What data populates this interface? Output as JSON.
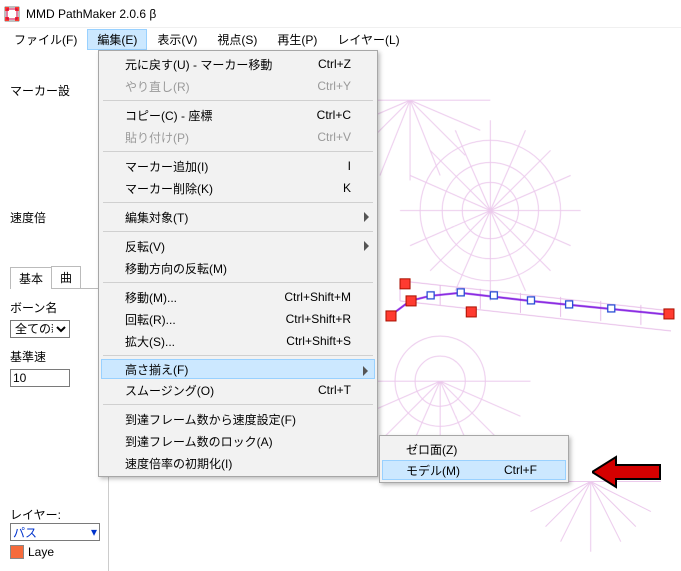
{
  "title": "MMD PathMaker 2.0.6 β",
  "menubar": {
    "file": "ファイル(F)",
    "edit": "編集(E)",
    "view": "表示(V)",
    "camera": "視点(S)",
    "play": "再生(P)",
    "layer": "レイヤー(L)"
  },
  "left": {
    "marker": "マーカー設",
    "speed": "速度倍",
    "tab_basic": "基本",
    "tab_curve": "曲",
    "bone_label": "ボーン名",
    "bone_value": "全ての新",
    "base_speed_label": "基準速",
    "base_speed_value": "10",
    "layer_label": "レイヤー:",
    "layer_combo": "パス",
    "layer_row": "Laye"
  },
  "edit_menu": {
    "undo": {
      "label": "元に戻す(U) - マーカー移動",
      "key": "Ctrl+Z"
    },
    "redo": {
      "label": "やり直し(R)",
      "key": "Ctrl+Y"
    },
    "copy": {
      "label": "コピー(C) - 座標",
      "key": "Ctrl+C"
    },
    "paste": {
      "label": "貼り付け(P)",
      "key": "Ctrl+V"
    },
    "add": {
      "label": "マーカー追加(I)",
      "key": "I"
    },
    "del": {
      "label": "マーカー削除(K)",
      "key": "K"
    },
    "target": {
      "label": "編集対象(T)"
    },
    "flip": {
      "label": "反転(V)"
    },
    "flip_dir": {
      "label": "移動方向の反転(M)"
    },
    "move": {
      "label": "移動(M)...",
      "key": "Ctrl+Shift+M"
    },
    "rotate": {
      "label": "回転(R)...",
      "key": "Ctrl+Shift+R"
    },
    "scale": {
      "label": "拡大(S)...",
      "key": "Ctrl+Shift+S"
    },
    "align_h": {
      "label": "高さ揃え(F)"
    },
    "smoothing": {
      "label": "スムージング(O)",
      "key": "Ctrl+T"
    },
    "speed_from": {
      "label": "到達フレーム数から速度設定(F)"
    },
    "lock_frames": {
      "label": "到達フレーム数のロック(A)"
    },
    "reset_speed": {
      "label": "速度倍率の初期化(I)"
    }
  },
  "submenu": {
    "zero": {
      "label": "ゼロ面(Z)"
    },
    "model": {
      "label": "モデル(M)",
      "key": "Ctrl+F"
    }
  }
}
